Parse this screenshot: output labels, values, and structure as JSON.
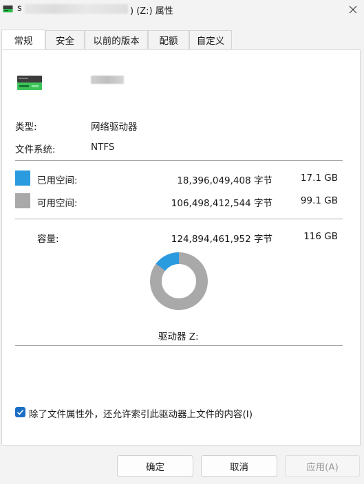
{
  "window": {
    "title_prefix": "s",
    "title_suffix": ") (Z:) 属性"
  },
  "tabs": [
    {
      "label": "常规",
      "active": true
    },
    {
      "label": "安全"
    },
    {
      "label": "以前的版本"
    },
    {
      "label": "配额"
    },
    {
      "label": "自定义"
    }
  ],
  "general": {
    "type_label": "类型:",
    "type_value": "网络驱动器",
    "fs_label": "文件系统:",
    "fs_value": "NTFS",
    "used": {
      "label": "已用空间:",
      "bytes": "18,396,049,408 字节",
      "size": "17.1 GB",
      "color": "#2b9be0"
    },
    "free": {
      "label": "可用空间:",
      "bytes": "106,498,412,544 字节",
      "size": "99.1 GB",
      "color": "#a9a9a9"
    },
    "capacity": {
      "label": "容量:",
      "bytes": "124,894,461,952 字节",
      "size": "116 GB"
    },
    "used_fraction": 0.147,
    "drive_caption": "驱动器 Z:",
    "index_checkbox": {
      "label": "除了文件属性外，还允许索引此驱动器上文件的内容(I)",
      "checked": true
    }
  },
  "buttons": {
    "ok": "确定",
    "cancel": "取消",
    "apply": "应用(A)"
  }
}
